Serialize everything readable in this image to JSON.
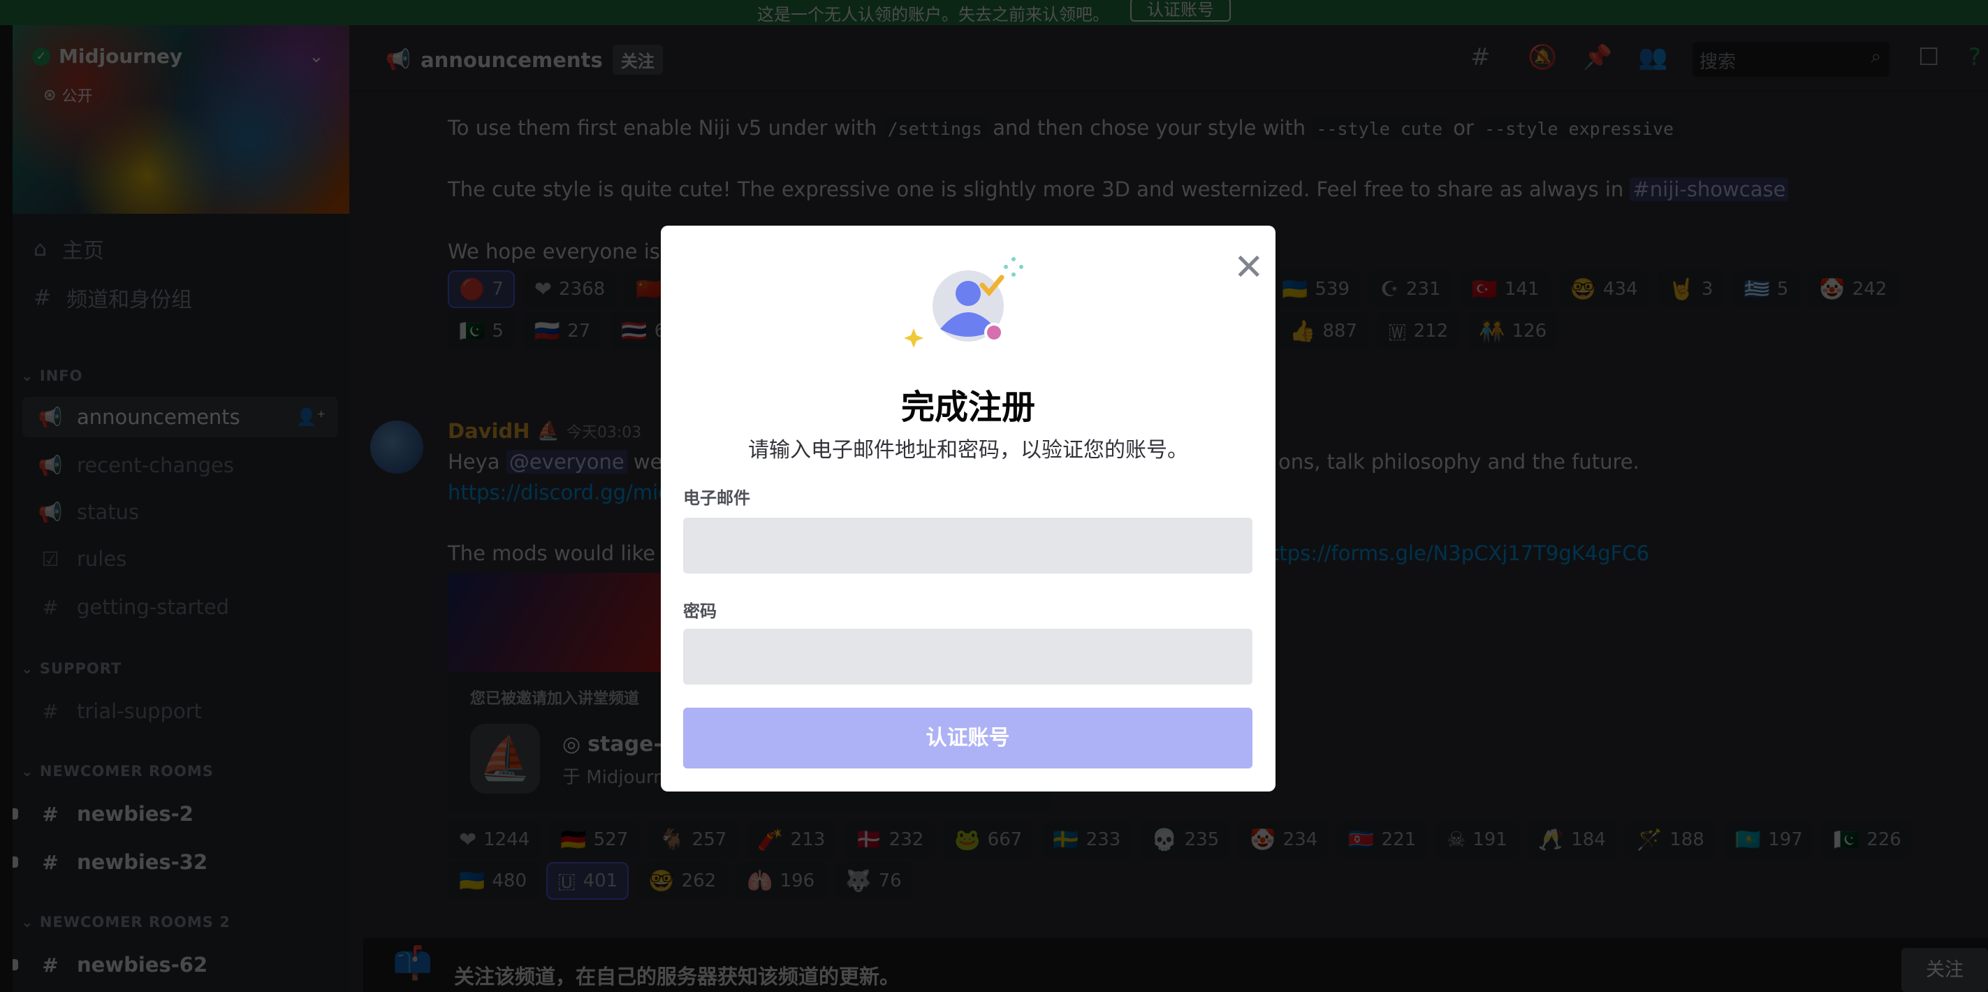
{
  "banner": {
    "text": "这是一个无人认领的账户。失去之前来认领吧。",
    "button": "认证账号"
  },
  "server": {
    "name": "Midjourney",
    "visibility": "公开"
  },
  "sidebar": {
    "nav": [
      {
        "icon": "home-icon",
        "glyph": "⌂",
        "label": "主页"
      },
      {
        "icon": "channels-roles-icon",
        "glyph": "#",
        "label": "频道和身份组"
      }
    ],
    "sections": [
      {
        "category": "INFO",
        "channels": [
          {
            "icon": "megaphone-icon",
            "glyph": "📢",
            "name": "announcements",
            "selected": true
          },
          {
            "icon": "megaphone-icon",
            "glyph": "📢",
            "name": "recent-changes"
          },
          {
            "icon": "megaphone-icon",
            "glyph": "📢",
            "name": "status"
          },
          {
            "icon": "rules-checkbox-icon",
            "glyph": "☑",
            "name": "rules"
          },
          {
            "icon": "hash-icon",
            "glyph": "#",
            "name": "getting-started"
          }
        ]
      },
      {
        "category": "SUPPORT",
        "channels": [
          {
            "icon": "hash-lock-icon",
            "glyph": "#",
            "name": "trial-support"
          }
        ]
      },
      {
        "category": "NEWCOMER ROOMS",
        "channels": [
          {
            "icon": "hash-lock-icon",
            "glyph": "#",
            "name": "newbies-2",
            "unread": true
          },
          {
            "icon": "hash-lock-icon",
            "glyph": "#",
            "name": "newbies-32",
            "unread": true
          }
        ]
      },
      {
        "category": "NEWCOMER ROOMS 2",
        "channels": [
          {
            "icon": "hash-lock-icon",
            "glyph": "#",
            "name": "newbies-62",
            "unread": true
          }
        ]
      }
    ]
  },
  "header": {
    "channel": "announcements",
    "follow": "关注",
    "search_placeholder": "搜索"
  },
  "messages": {
    "m1": {
      "line1": {
        "a": "To use them first enable Niji v5 under with ",
        "c1": "/settings",
        "b": " and then chose your style with ",
        "c2": "--style cute",
        "d": " or ",
        "c3": "--style expressive"
      },
      "line2": {
        "a": "The cute style is quite cute! The expressive one is slightly more 3D and westernized. Feel free to share as always in ",
        "channel": "#niji-showcase"
      },
      "line3": "We hope everyone is h",
      "reactions_row1_left": [
        {
          "e": "🔴",
          "n": "7",
          "me": true
        },
        {
          "e": "❤",
          "n": "2368"
        },
        {
          "e": "🇨🇳",
          "n": ""
        }
      ],
      "reactions_row1_right": [
        {
          "e": "🇺🇦",
          "n": "539"
        },
        {
          "e": "☪",
          "n": "231"
        },
        {
          "e": "🇹🇷",
          "n": "141"
        },
        {
          "e": "🤓",
          "n": "434"
        },
        {
          "e": "🤘",
          "n": "3"
        },
        {
          "e": "🇬🇷",
          "n": "5"
        },
        {
          "e": "🤡",
          "n": "242"
        }
      ],
      "reactions_row2_left": [
        {
          "e": "🇵🇰",
          "n": "5"
        },
        {
          "e": "🇷🇺",
          "n": "27"
        },
        {
          "e": "🇹🇭",
          "n": "6"
        }
      ],
      "reactions_row2_right": [
        {
          "e": "👍",
          "n": "887"
        },
        {
          "e": "🇼",
          "n": "212"
        },
        {
          "e": "🧑‍🤝‍🧑",
          "n": "126"
        }
      ]
    },
    "m2": {
      "author": "DavidH",
      "badge": "⛵",
      "time": "今天03:03",
      "line1": {
        "a": "Heya ",
        "mention": "@everyone",
        "b": " we'r",
        "c": "ons, talk philosophy and the future."
      },
      "line2": "https://discord.gg/mid",
      "line3": {
        "a": "The mods would like yo",
        "link": "ttps://forms.gle/N3pCXj17T9gK4gFC6"
      },
      "embed": {
        "title": "您已被邀请加入讲堂频道",
        "stage": "stage-",
        "server": "于 Midjourn"
      },
      "reactions_row1": [
        {
          "e": "❤",
          "n": "1244"
        },
        {
          "e": "🇩🇪",
          "n": "527"
        },
        {
          "e": "🐐",
          "n": "257"
        },
        {
          "e": "🧨",
          "n": "213"
        },
        {
          "e": "🇩🇰",
          "n": "232"
        },
        {
          "e": "🐸",
          "n": "667"
        },
        {
          "e": "🇸🇪",
          "n": "233"
        },
        {
          "e": "💀",
          "n": "235"
        },
        {
          "e": "🤡",
          "n": "234"
        },
        {
          "e": "🇰🇵",
          "n": "221"
        },
        {
          "e": "☠",
          "n": "191"
        },
        {
          "e": "🥂",
          "n": "184"
        },
        {
          "e": "🪄",
          "n": "188"
        },
        {
          "e": "🇰🇿",
          "n": "197"
        },
        {
          "e": "🇵🇰",
          "n": "226"
        }
      ],
      "reactions_row2": [
        {
          "e": "🇺🇦",
          "n": "480"
        },
        {
          "e": "🇺",
          "n": "401",
          "me": true
        },
        {
          "e": "🤓",
          "n": "262"
        },
        {
          "e": "🫁",
          "n": "196"
        },
        {
          "e": "🐺",
          "n": "76"
        }
      ]
    }
  },
  "bottombar": {
    "text": "关注该频道，在自己的服务器获知该频道的更新。",
    "button": "关注"
  },
  "modal": {
    "title": "完成注册",
    "subtitle": "请输入电子邮件地址和密码，以验证您的账号。",
    "email_label": "电子邮件",
    "email_value": "",
    "password_label": "密码",
    "password_value": "",
    "submit": "认证账号",
    "colors": {
      "button": "#adb1f5",
      "input": "#e3e5e8",
      "avatar": "#6b7ff0",
      "check": "#f0b232",
      "dot": "#d66fb0"
    }
  }
}
